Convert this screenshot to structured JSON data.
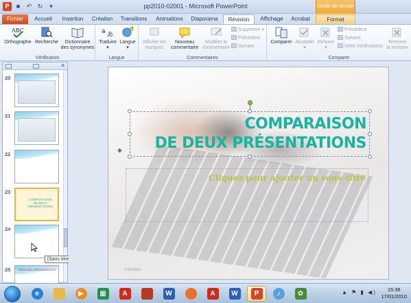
{
  "window": {
    "title": "pp2010-02001  -  Microsoft PowerPoint",
    "context_group": "Outils de dessin"
  },
  "tabs": [
    {
      "label": "Fichier"
    },
    {
      "label": "Accueil"
    },
    {
      "label": "Insertion"
    },
    {
      "label": "Création"
    },
    {
      "label": "Transitions"
    },
    {
      "label": "Animations"
    },
    {
      "label": "Diaporama"
    },
    {
      "label": "Révision"
    },
    {
      "label": "Affichage"
    },
    {
      "label": "Acrobat"
    },
    {
      "label": "Format"
    }
  ],
  "ribbon": {
    "verification": {
      "label": "Vérification",
      "orthographe": "Orthographe",
      "recherche": "Recherche",
      "dictionnaire_1": "Dictionnaire",
      "dictionnaire_2": "des synonymes"
    },
    "langue": {
      "label": "Langue",
      "traduire": "Traduire",
      "langue": "Langue"
    },
    "commentaires": {
      "label": "Commentaires",
      "afficher_1": "Afficher les",
      "afficher_2": "marques",
      "nouveau_1": "Nouveau",
      "nouveau_2": "commentaire",
      "modifier_1": "Modifier le",
      "modifier_2": "commentaire",
      "supprimer": "Supprimer",
      "precedent": "Précédent",
      "suivant": "Suivant"
    },
    "comparer": {
      "label": "Comparer",
      "comparer": "Comparer",
      "accepter": "Accepter",
      "refuser": "Refuser",
      "precedent": "Précédent",
      "suivant": "Suivant",
      "volet": "Volet Vérifications",
      "terminer_1": "Terminer",
      "terminer_2": "la révision"
    }
  },
  "slides_pane": {
    "thumbnails": [
      {
        "number": "20"
      },
      {
        "number": "21"
      },
      {
        "number": "22"
      },
      {
        "number": "23"
      },
      {
        "number": "24"
      },
      {
        "number": "25"
      }
    ],
    "thumb23_text": "COMPARAISON\nDE DEUX PRÉSENTATIONS",
    "thumb25_text": "TRIER DES PRÉSENTATIONS",
    "tooltip": "[Sans titre]"
  },
  "slide": {
    "title_line1": "COMPARAISON",
    "title_line2": "DE DEUX PRÉSENTATIONS",
    "subtitle_placeholder": "Cliquez pour ajouter un sous-titre",
    "date": "17/01/2010"
  },
  "taskbar": {
    "time": "15:38",
    "date": "17/01/2010"
  },
  "colors": {
    "title_teal": "#19b3a0",
    "subtitle_olive": "#b7c44a",
    "file_tab": "#c94e22",
    "context_orange": "#f0a93a"
  }
}
